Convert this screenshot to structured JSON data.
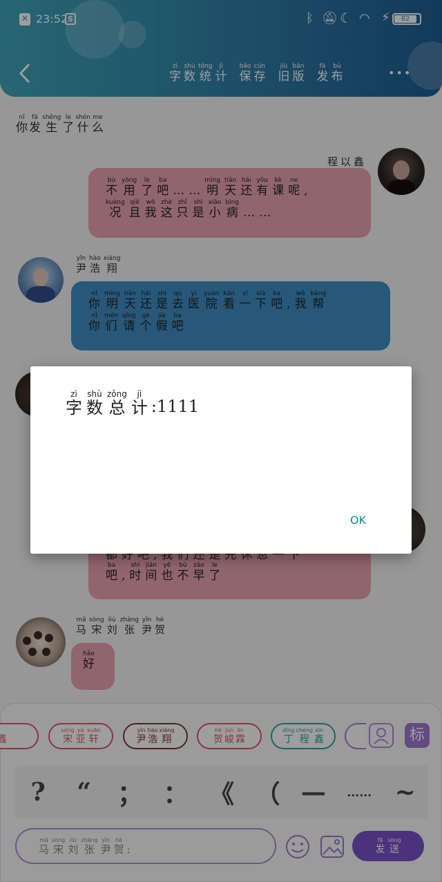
{
  "status_bar": {
    "time": "23:52",
    "battery": "82"
  },
  "header": {
    "actions": [
      {
        "label": "字数统计",
        "pinyin": [
          "zì",
          "shù",
          "tǒng",
          "jì"
        ]
      },
      {
        "label": "保存",
        "pinyin": [
          "bǎo",
          "cún"
        ]
      },
      {
        "label": "旧版",
        "pinyin": [
          "jiù",
          "bǎn"
        ]
      },
      {
        "label": "发布",
        "pinyin": [
          "fā",
          "bù"
        ]
      }
    ],
    "more": "•••"
  },
  "messages": [
    {
      "type": "narration",
      "chars": [
        "你",
        "发",
        "生",
        "了",
        "什",
        "么"
      ],
      "pinyin": [
        "nǐ",
        "fā",
        "shēng",
        "le",
        "shén",
        "me"
      ]
    },
    {
      "type": "right",
      "sender": "程以鑫",
      "line1_chars": [
        "不",
        "用",
        "了",
        "吧",
        "…",
        "…",
        "明",
        "天",
        "还",
        "有",
        "课",
        "呢",
        ","
      ],
      "line1_pinyin": [
        "bù",
        "yòng",
        "le",
        "ba",
        "",
        "",
        "míng",
        "tiān",
        "hái",
        "yǒu",
        "kè",
        "ne",
        ""
      ],
      "line2_chars": [
        "况",
        "且",
        "我",
        "这",
        "只",
        "是",
        "小",
        "病",
        "…",
        "…"
      ],
      "line2_pinyin": [
        "kuàng",
        "qiě",
        "wǒ",
        "zhè",
        "zhǐ",
        "shì",
        "xiǎo",
        "bìng",
        "",
        ""
      ]
    },
    {
      "type": "left",
      "sender": "尹浩翔",
      "sender_pinyin": [
        "yǐn",
        "hào",
        "xiáng"
      ],
      "line1_chars": [
        "你",
        "明",
        "天",
        "还",
        "是",
        "去",
        "医",
        "院",
        "看",
        "一",
        "下",
        "吧",
        ",",
        "我",
        "帮"
      ],
      "line1_pinyin": [
        "nǐ",
        "míng",
        "tiān",
        "hái",
        "shì",
        "qù",
        "yī",
        "yuàn",
        "kàn",
        "yī",
        "xià",
        "ba",
        "",
        "wǒ",
        "bāng"
      ],
      "line2_chars": [
        "你",
        "们",
        "请",
        "个",
        "假",
        "吧"
      ],
      "line2_pinyin": [
        "nǐ",
        "mén",
        "qǐng",
        "gè",
        "jià",
        "ba"
      ]
    },
    {
      "type": "right-partial",
      "line1_chars": [
        "都",
        "好",
        "吧",
        ",",
        "我",
        "们",
        "还",
        "是",
        "先",
        "休",
        "息",
        "一",
        "下"
      ],
      "line2_chars": [
        "吧",
        ",",
        "时",
        "间",
        "也",
        "不",
        "早",
        "了"
      ],
      "line2_pinyin": [
        "ba",
        "",
        "shí",
        "jiān",
        "yě",
        "bù",
        "zǎo",
        "le"
      ]
    },
    {
      "type": "left",
      "sender": "马宋刘张尹贺",
      "sender_pinyin": [
        "mǎ",
        "sòng",
        "liú",
        "zhāng",
        "yǐn",
        "hè"
      ],
      "text_chars": [
        "好"
      ],
      "text_pinyin": [
        "hǎo"
      ]
    }
  ],
  "dialog": {
    "title_chars": [
      "字",
      "数",
      "总",
      "计"
    ],
    "title_pinyin": [
      "zì",
      "shù",
      "zǒng",
      "jì"
    ],
    "value": ":1111",
    "ok": "OK"
  },
  "character_chips": [
    {
      "label": "鑫",
      "color": "#e0556e"
    },
    {
      "label": "宋亚轩",
      "pinyin": [
        "sòng",
        "yà",
        "xuān"
      ],
      "color": "#e0556e"
    },
    {
      "label": "尹浩翔",
      "pinyin": [
        "yǐn",
        "hào",
        "xiáng"
      ],
      "color": "#7a3a35"
    },
    {
      "label": "贺峻霖",
      "pinyin": [
        "hè",
        "jùn",
        "lín"
      ],
      "color": "#e0556e"
    },
    {
      "label": "丁程鑫",
      "pinyin": [
        "dīng",
        "chéng",
        "xīn"
      ],
      "color": "#2fa59b"
    }
  ],
  "tag_button": "标",
  "punctuation": [
    "?",
    "“",
    "；",
    "：",
    "《",
    "（",
    "—",
    "……",
    "~"
  ],
  "input": {
    "placeholder_chars": [
      "马",
      "宋",
      "刘",
      "张",
      "尹",
      "贺",
      ":"
    ],
    "placeholder_pinyin": [
      "mǎ",
      "sòng",
      "liú",
      "zhāng",
      "yǐn",
      "hè",
      ""
    ]
  },
  "send_button": {
    "label": "发送",
    "pinyin": [
      "fā",
      "sòng"
    ]
  },
  "colors": {
    "accent": "#7b4fc9",
    "pink_bubble": "#eaa4b2",
    "blue_bubble": "#3f8ec4",
    "ok_text": "#0a8f8a"
  }
}
